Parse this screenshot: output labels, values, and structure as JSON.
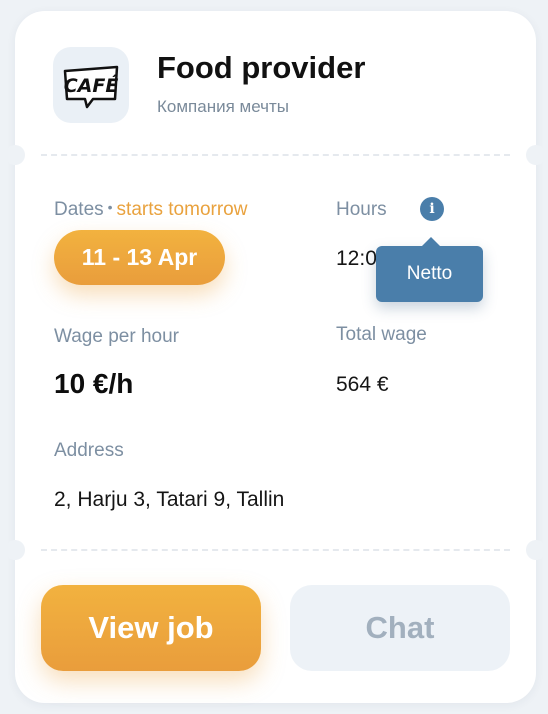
{
  "company": {
    "logo_text": "CAFÉ",
    "name": "Food provider",
    "subtitle": "Компания мечты"
  },
  "dates": {
    "label": "Dates",
    "separator": "•",
    "status": "starts tomorrow",
    "range": "11 - 13 Apr"
  },
  "hours": {
    "label": "Hours",
    "value_partial": "12:0",
    "info_icon": "info-icon",
    "tooltip": "Netto"
  },
  "wage": {
    "label": "Wage per hour",
    "value": "10 €/h"
  },
  "total": {
    "label": "Total wage",
    "value": "564 €"
  },
  "address": {
    "label": "Address",
    "value": "2, Harju 3, Tatari 9, Tallin"
  },
  "actions": {
    "view_job": "View job",
    "chat": "Chat"
  },
  "colors": {
    "accent": "#e9a23e",
    "info": "#4a7eaa",
    "label": "#7d8fa2"
  }
}
